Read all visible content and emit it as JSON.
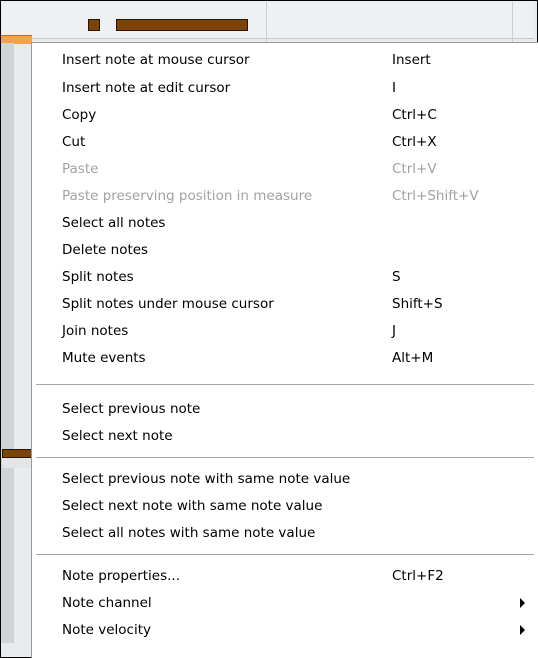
{
  "menu": {
    "items": [
      {
        "label": "Insert note at mouse cursor",
        "shortcut": "Insert",
        "disabled": false
      },
      {
        "label": "Insert note at edit cursor",
        "shortcut": "I",
        "disabled": false
      },
      {
        "label": "Copy",
        "shortcut": "Ctrl+C",
        "disabled": false
      },
      {
        "label": "Cut",
        "shortcut": "Ctrl+X",
        "disabled": false
      },
      {
        "label": "Paste",
        "shortcut": "Ctrl+V",
        "disabled": true
      },
      {
        "label": "Paste preserving position in measure",
        "shortcut": "Ctrl+Shift+V",
        "disabled": true
      },
      {
        "label": "Select all notes",
        "shortcut": "",
        "disabled": false
      },
      {
        "label": "Delete notes",
        "shortcut": "",
        "disabled": false
      },
      {
        "label": "Split notes",
        "shortcut": "S",
        "disabled": false
      },
      {
        "label": "Split notes under mouse cursor",
        "shortcut": "Shift+S",
        "disabled": false
      },
      {
        "label": "Join notes",
        "shortcut": "J",
        "disabled": false
      },
      {
        "label": "Mute events",
        "shortcut": "Alt+M",
        "disabled": false
      },
      {
        "label": "Select previous note",
        "shortcut": "",
        "disabled": false
      },
      {
        "label": "Select next note",
        "shortcut": "",
        "disabled": false
      },
      {
        "label": "Select previous note with same note value",
        "shortcut": "",
        "disabled": false
      },
      {
        "label": "Select next note with same note value",
        "shortcut": "",
        "disabled": false
      },
      {
        "label": "Select all notes with same note value",
        "shortcut": "",
        "disabled": false
      },
      {
        "label": "Note properties...",
        "shortcut": "Ctrl+F2",
        "disabled": false
      },
      {
        "label": "Note channel",
        "shortcut": "",
        "disabled": false,
        "submenu": true
      },
      {
        "label": "Note velocity",
        "shortcut": "",
        "disabled": false,
        "submenu": true
      }
    ]
  },
  "colors": {
    "note": "#7b4308",
    "selection_strip": "#f4a24a",
    "disabled_text": "#a2a2a2",
    "menu_bg": "#ffffff"
  }
}
